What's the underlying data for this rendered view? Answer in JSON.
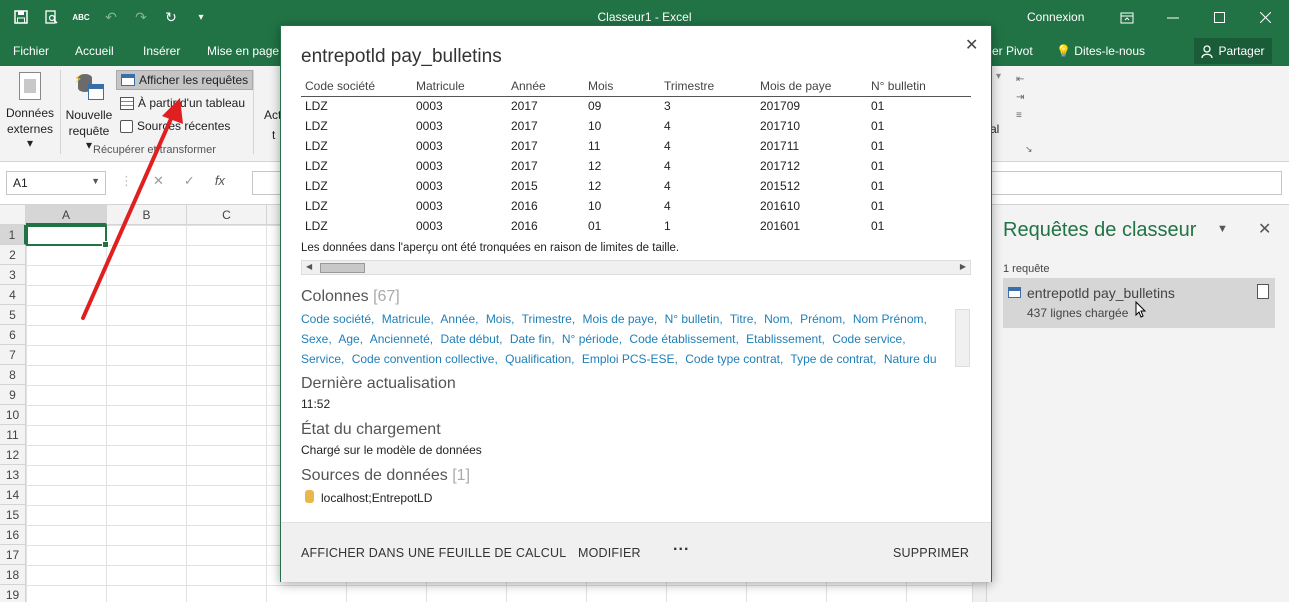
{
  "titlebar": {
    "title": "Classeur1  -  Excel",
    "signin": "Connexion"
  },
  "qat": {
    "save": "save-icon",
    "preview": "print-preview-icon",
    "spell": "ABC",
    "undo": "↶",
    "redo": "↷",
    "refresh": "↻",
    "customize": "▾"
  },
  "tabs": {
    "file": "Fichier",
    "home": "Accueil",
    "insert": "Insérer",
    "layout": "Mise en page",
    "pivot": "er Pivot",
    "tell": "Dites-le-nous",
    "share": "Partager"
  },
  "ribbon": {
    "external_data": "Données externes ▾",
    "external_l1": "Données",
    "external_l2": "externes ▾",
    "new_query_l1": "Nouvelle",
    "new_query_l2": "requête ▾",
    "show_queries": "Afficher les requêtes",
    "from_table": "À partir d'un tableau",
    "recent_sources": "Sources récentes",
    "group_label": "Récupérer et transformer",
    "act_l1": "Act",
    "act_l2": "t",
    "right_l1": "al"
  },
  "formula_bar": {
    "name_box": "A1",
    "fx": "fx"
  },
  "grid": {
    "columns": [
      "A",
      "B",
      "C"
    ],
    "rows": [
      "1",
      "2",
      "3",
      "4",
      "5",
      "6",
      "7",
      "8",
      "9",
      "10",
      "11",
      "12",
      "13",
      "14",
      "15",
      "16",
      "17",
      "18",
      "19"
    ]
  },
  "queries_pane": {
    "title": "Requêtes de classeur",
    "count": "1 requête",
    "item_name": "entrepotld pay_bulletins",
    "item_status": "437 lignes chargée"
  },
  "popup": {
    "title": "entrepotld pay_bulletins",
    "headers": [
      "Code société",
      "Matricule",
      "Année",
      "Mois",
      "Trimestre",
      "Mois de paye",
      "N° bulletin"
    ],
    "rows": [
      [
        "LDZ",
        "0003",
        "2017",
        "09",
        "3",
        "201709",
        "01"
      ],
      [
        "LDZ",
        "0003",
        "2017",
        "10",
        "4",
        "201710",
        "01"
      ],
      [
        "LDZ",
        "0003",
        "2017",
        "11",
        "4",
        "201711",
        "01"
      ],
      [
        "LDZ",
        "0003",
        "2017",
        "12",
        "4",
        "201712",
        "01"
      ],
      [
        "LDZ",
        "0003",
        "2015",
        "12",
        "4",
        "201512",
        "01"
      ],
      [
        "LDZ",
        "0003",
        "2016",
        "10",
        "4",
        "201610",
        "01"
      ],
      [
        "LDZ",
        "0003",
        "2016",
        "01",
        "1",
        "201601",
        "01"
      ]
    ],
    "truncated_note": "Les données dans l'aperçu ont été tronquées en raison de limites de taille.",
    "columns_title": "Colonnes",
    "columns_count": "[67]",
    "columns": [
      "Code société,",
      "Matricule,",
      "Année,",
      "Mois,",
      "Trimestre,",
      "Mois de paye,",
      "N° bulletin,",
      "Titre,",
      "Nom,",
      "Prénom,",
      "Nom Prénom,",
      "Sexe,",
      "Age,",
      "Ancienneté,",
      "Date début,",
      "Date fin,",
      "N° période,",
      "Code établissement,",
      "Etablissement,",
      "Code service,",
      "Service,",
      "Code convention collective,",
      "Qualification,",
      "Emploi PCS-ESE,",
      "Code type contrat,",
      "Type de contrat,",
      "Nature du contrat,"
    ],
    "last_refresh_title": "Dernière actualisation",
    "last_refresh_value": "11:52",
    "load_state_title": "État du chargement",
    "load_state_value": "Chargé sur le modèle de données",
    "sources_title": "Sources de données",
    "sources_count": "[1]",
    "source_value": "localhost;EntrepotLD",
    "footer": {
      "show_sheet": "AFFICHER DANS UNE FEUILLE DE CALCUL",
      "modify": "MODIFIER",
      "more": "···",
      "delete": "SUPPRIMER"
    }
  },
  "colors": {
    "excel_green": "#217346",
    "link_blue": "#1f7fb8",
    "arrow_red": "#e02020"
  }
}
